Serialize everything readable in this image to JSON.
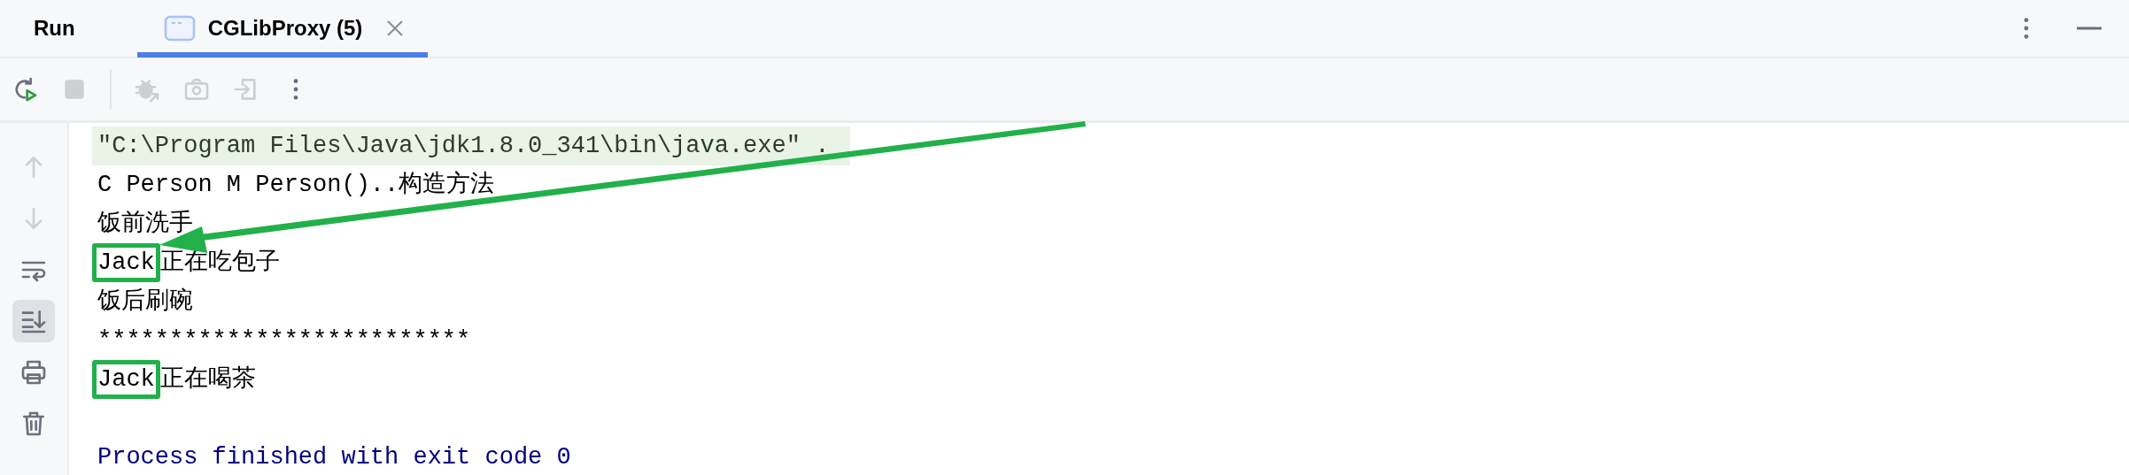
{
  "panel": {
    "title": "Run"
  },
  "tabs": [
    {
      "label": "CGLibProxy (5)",
      "selected": true,
      "closable": true
    }
  ],
  "toolbar": [
    {
      "kind": "rerun",
      "disabled": false
    },
    {
      "kind": "stop",
      "disabled": true
    },
    {
      "kind": "divider",
      "disabled": false
    },
    {
      "kind": "debug",
      "disabled": true
    },
    {
      "kind": "camera",
      "disabled": true
    },
    {
      "kind": "exit",
      "disabled": true
    },
    {
      "kind": "more",
      "disabled": false
    }
  ],
  "side_tools": [
    {
      "kind": "up",
      "disabled": true,
      "selected": false
    },
    {
      "kind": "down",
      "disabled": true,
      "selected": false
    },
    {
      "kind": "wrap",
      "disabled": false,
      "selected": false
    },
    {
      "kind": "scroll-end",
      "disabled": false,
      "selected": true
    },
    {
      "kind": "print",
      "disabled": false,
      "selected": false
    },
    {
      "kind": "trash",
      "disabled": false,
      "selected": false
    }
  ],
  "console": [
    {
      "kind": "command",
      "segments": [
        {
          "text": "\"C:\\Program Files\\Java\\jdk1.8.0_341\\bin\\java.exe\" .",
          "boxed": false
        }
      ]
    },
    {
      "kind": "output",
      "segments": [
        {
          "text": "C Person M Person()..构造方法",
          "boxed": false
        }
      ]
    },
    {
      "kind": "output",
      "segments": [
        {
          "text": "饭前洗手",
          "boxed": false
        }
      ]
    },
    {
      "kind": "output",
      "segments": [
        {
          "text": "Jack",
          "boxed": true
        },
        {
          "text": "正在吃包子",
          "boxed": false
        }
      ]
    },
    {
      "kind": "output",
      "segments": [
        {
          "text": "饭后刷碗",
          "boxed": false
        }
      ]
    },
    {
      "kind": "output",
      "segments": [
        {
          "text": "**************************",
          "boxed": false
        }
      ]
    },
    {
      "kind": "output",
      "segments": [
        {
          "text": "Jack",
          "boxed": true
        },
        {
          "text": "正在喝茶",
          "boxed": false
        }
      ]
    },
    {
      "kind": "exit",
      "segments": [
        {
          "text": "Process finished with exit code 0",
          "boxed": false
        }
      ]
    }
  ]
}
